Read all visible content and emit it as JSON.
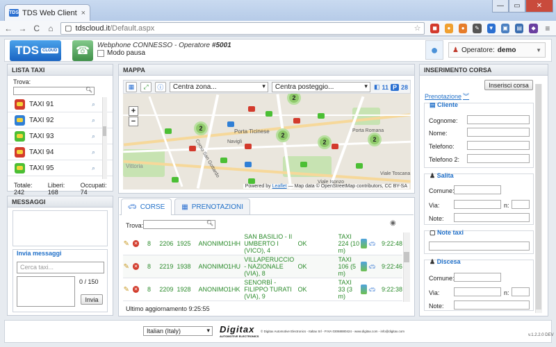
{
  "browser": {
    "tab_title": "TDS Web Client",
    "tab_favicon": "TDS",
    "url_host": "tdscloud.it",
    "url_path": "/Default.aspx",
    "nav_back": "←",
    "nav_forward": "→",
    "nav_reload": "C",
    "win_min": "—",
    "win_max": "▭",
    "win_close": "✕",
    "tab_close": "×"
  },
  "header": {
    "logo_text": "TDS",
    "logo_sub": "CLOUD",
    "webphone_status": "Webphone CONNESSO - Operatore ",
    "operator_code": "#5001",
    "pausa_label": "Modo pausa",
    "operatore_label": "Operatore:",
    "operatore_name": "demo"
  },
  "lista_taxi": {
    "title": "LISTA TAXI",
    "search_label": "Trova:",
    "items": [
      {
        "label": "TAXI 91",
        "color": "#d33a2c"
      },
      {
        "label": "TAXI 92",
        "color": "#2f7fd6"
      },
      {
        "label": "TAXI 93",
        "color": "#4bbf34"
      },
      {
        "label": "TAXI 94",
        "color": "#d33a2c"
      },
      {
        "label": "TAXI 95",
        "color": "#4bbf34"
      }
    ],
    "totale": "Totale: 242",
    "liberi": "Liberi: 168",
    "occupati": "Occupati: 74"
  },
  "messaggi": {
    "title": "MESSAGGI",
    "invia_title": "Invia messaggi",
    "cerca_placeholder": "Cerca taxi...",
    "counter": "0 / 150",
    "invia_btn": "Invia"
  },
  "mappa": {
    "title": "MAPPA",
    "zona_select": "Centra zona...",
    "posteggio_select": "Centra posteggio...",
    "badge_taxi": "11",
    "badge_p": "P",
    "badge_p_count": "28",
    "zoom_in": "+",
    "zoom_out": "−",
    "clusters": [
      "2",
      "2",
      "2",
      "2",
      "2"
    ],
    "labels": [
      "Porta Ticinese",
      "Porta Romana",
      "Navigli",
      "Viale Isonzo",
      "Viale Toscana",
      "Corso San Gottardo",
      "Vittoria"
    ],
    "attribution_prefix": "Powered by ",
    "attribution_link": "Leaflet",
    "attribution_rest": " — Map data © OpenStreetMap contributors, CC BY-SA"
  },
  "corse": {
    "tab_corse": "CORSE",
    "tab_prenotazioni": "PRENOTAZIONI",
    "search_label": "Trova:",
    "rows": [
      {
        "n": "8",
        "id": "2206",
        "t": "1925",
        "cliente": "ANONIMO",
        "code": "1HH",
        "via": "SAN BASILIO - II UMBERTO I (VICO), 4",
        "stato": "OK",
        "taxi": "TAXI 224 (10 m)",
        "ora": "9:22:48"
      },
      {
        "n": "8",
        "id": "2219",
        "t": "1938",
        "cliente": "ANONIMO",
        "code": "1HU",
        "via": "VILLAPERUCCIO - NAZIONALE (VIA), 8",
        "stato": "OK",
        "taxi": "TAXI 106 (5 m)",
        "ora": "9:22:46"
      },
      {
        "n": "8",
        "id": "2209",
        "t": "1928",
        "cliente": "ANONIMO",
        "code": "1HK",
        "via": "SENORBÌ - FILIPPO TURATI (VIA), 9",
        "stato": "OK",
        "taxi": "TAXI 33 (3 m)",
        "ora": "9:22:38"
      }
    ],
    "last_update": "Ultimo aggiornamento 9:25:55"
  },
  "inserimento": {
    "title": "INSERIMENTO CORSA",
    "insert_btn": "Inserisci corsa",
    "prenotazione": "Prenotazione",
    "cliente_title": "Cliente",
    "cognome": "Cognome:",
    "nome": "Nome:",
    "telefono": "Telefono:",
    "telefono2": "Telefono 2:",
    "salita_title": "Salita",
    "comune": "Comune:",
    "via": "Via:",
    "n": "n:",
    "note": "Note:",
    "note_taxi_title": "Note taxi",
    "discesa_title": "Discesa"
  },
  "footer": {
    "language": "Italian (Italy)",
    "brand": "Digitax",
    "brand_sub": "AUTOMOTIVE ELECTRONICS",
    "copyright": "© Digitax Automotive Electronics - Italtax Srl - P.IVA 03068880424 - www.digitax.com - info@digitax.com",
    "version": "v.1.2.2.0 DEV"
  }
}
